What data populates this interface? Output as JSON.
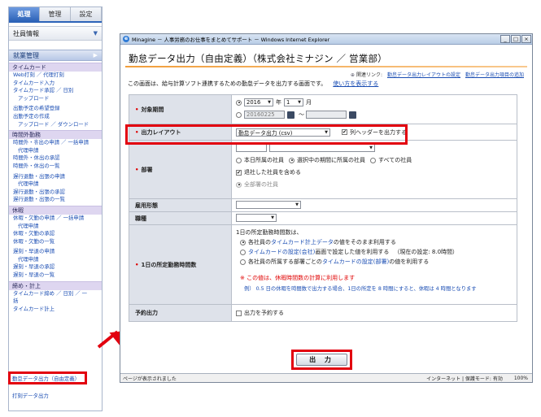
{
  "sidebar": {
    "tabs": [
      "処理",
      "管理",
      "設定"
    ],
    "select_label": "社員情報",
    "main_label": "就業管理",
    "groups": [
      {
        "title": "タイムカード",
        "links": [
          {
            "label": "Web打刻 ／ 代理打刻",
            "sub": false
          },
          {
            "label": "タイムカード入力",
            "sub": false
          },
          {
            "label": "タイムカード承認 ／ 日別",
            "sub": false
          },
          {
            "label": "アップロード",
            "sub": true
          },
          {
            "label": "出勤予定の希望登録",
            "sub": false,
            "gap": true
          },
          {
            "label": "出勤予定の作成",
            "sub": false
          },
          {
            "label": "アップロード ／ ダウンロード",
            "sub": true
          }
        ]
      },
      {
        "title": "時間外勤務",
        "links": [
          {
            "label": "時間外・휴出の申請 ／ 一括申請",
            "sub": false
          },
          {
            "label": "代理申請",
            "sub": true
          },
          {
            "label": "時間外・休出の承認",
            "sub": false
          },
          {
            "label": "時間外・休出の一覧",
            "sub": false
          },
          {
            "label": "遅行退勤・出張の申請",
            "sub": false,
            "gap": true
          },
          {
            "label": "代理申請",
            "sub": true
          },
          {
            "label": "遅行退勤・出張の承認",
            "sub": false
          },
          {
            "label": "遅行退勤・出張の一覧",
            "sub": false
          }
        ]
      },
      {
        "title": "休暇",
        "links": [
          {
            "label": "休暇・欠勤の申請 ／ 一括申請",
            "sub": false
          },
          {
            "label": "代理申請",
            "sub": true
          },
          {
            "label": "休暇・欠勤の承認",
            "sub": false
          },
          {
            "label": "休暇・欠勤の一覧",
            "sub": false
          },
          {
            "label": "遅刻・早退の申請",
            "sub": false,
            "gap": true
          },
          {
            "label": "代理申請",
            "sub": true
          },
          {
            "label": "遅刻・早退の承認",
            "sub": false
          },
          {
            "label": "遅刻・早退の一覧",
            "sub": false
          }
        ]
      },
      {
        "title": "締め・計上",
        "links": [
          {
            "label": "タイムカード締め ／ 日別 ／ 一",
            "sub": false
          },
          {
            "label": "括",
            "sub": false
          },
          {
            "label": "タイムカード計上",
            "sub": false
          }
        ]
      }
    ],
    "highlighted_link": "勤怠データ出力（自由定義）",
    "last_link": "打刻データ出力"
  },
  "window": {
    "title": "Minagine － 人事労務のお仕事をまとめてサポート － Windows Internet Explorer",
    "buttons": [
      "_",
      "□",
      "×"
    ],
    "page_title": "勤怠データ出力（自由定義）（株式会社ミナジン ／ 営業部）",
    "related_label": "関連リンク:",
    "related_links": [
      "勤怠データ出力レイアウトの設定",
      "勤怠データ出力項目の追加"
    ],
    "description": "この画面は、給与計算ソフト連携するための勤怠データを出力する画面です。",
    "howto_link": "使い方を表示する",
    "form": {
      "period": {
        "label": "対象期間",
        "year": "2016",
        "year_unit": "年",
        "month": "1",
        "month_unit": "月",
        "date_from": "20160225",
        "tilde": "～",
        "date_to": ""
      },
      "layout": {
        "label": "出力レイアウト",
        "value": "勤怠データ出力 (csv)",
        "header_checkbox": "列ヘッダーを出力する"
      },
      "department": {
        "label": "部署",
        "options": [
          "本日所属の社員",
          "選択中の期間に所属の社員",
          "すべての社員"
        ],
        "include_retired": "退社した社員を含める",
        "all_departments": "全部署の社員"
      },
      "employment": {
        "label": "雇用形態"
      },
      "position": {
        "label": "職種"
      },
      "hours": {
        "label": "1日の所定勤務時間数",
        "intro": "1日の所定勤務時間数は、",
        "opt1_a": "各社員の",
        "opt1_link": "タイムカード計上データ",
        "opt1_b": "の値をそのまま利用する",
        "opt2_link": "タイムカードの設定(会社)",
        "opt2_b": "画面で設定した値を利用する",
        "opt2_current": "（現在の設定: 8.0時間）",
        "opt3_a": "各社員の所属する部署ごとの",
        "opt3_link": "タイムカードの設定(部署)",
        "opt3_b": "の値を利用する",
        "warning": "※ この値は、休暇時間数の計算に利用します",
        "example": "例） 0.5 日の休暇を時間数で出力する場合、1日の所定を 8 時間にすると、休暇は 4 時間となります"
      },
      "schedule": {
        "label": "予約出力",
        "checkbox": "出力を予約する"
      }
    },
    "submit_label": "出 力",
    "status": {
      "left": "ページが表示されました",
      "zone": "インターネット | 保護モード: 有効",
      "zoom": "100%"
    }
  },
  "colors": {
    "accent_red": "#e2000f",
    "link_blue": "#1a4db3",
    "title_rule": "#f19e3b",
    "label_bg": "#dee2ea"
  }
}
